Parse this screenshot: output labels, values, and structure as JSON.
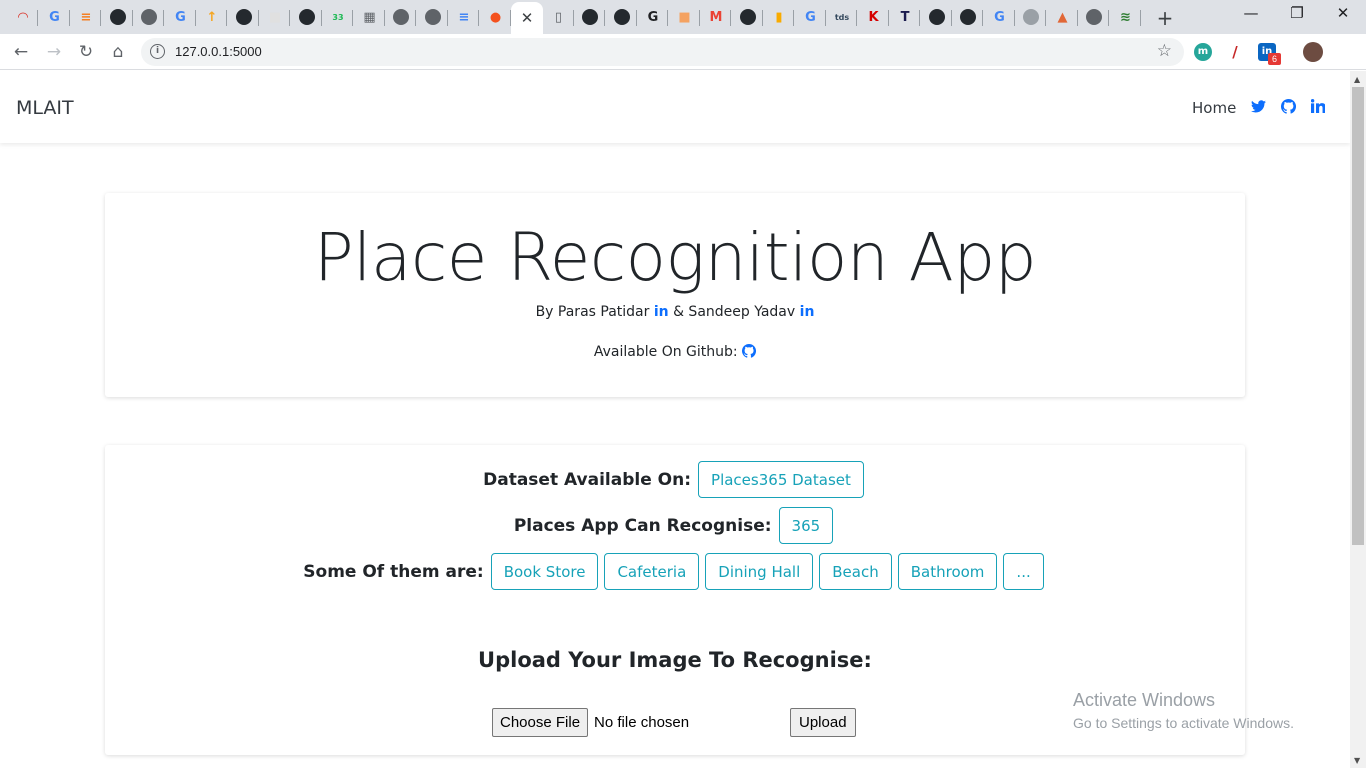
{
  "browser": {
    "active_tab_close": "✕",
    "new_tab": "+",
    "window_controls": [
      "—",
      "❐",
      "✕"
    ],
    "url": "127.0.0.1:5000",
    "star": "☆",
    "nav": {
      "back": "←",
      "forward": "→",
      "reload": "↻",
      "home": "⌂"
    },
    "tabs": [
      {
        "icon": "speedometer-icon",
        "color": "#d93025",
        "glyph": "◠"
      },
      {
        "icon": "google-icon",
        "color": "#4285f4",
        "glyph": "G"
      },
      {
        "icon": "stackoverflow-icon",
        "color": "#f48024",
        "glyph": "≡"
      },
      {
        "icon": "github-icon",
        "color": "#24292e",
        "glyph": "●"
      },
      {
        "icon": "globe-icon",
        "color": "#5f6368",
        "glyph": "●"
      },
      {
        "icon": "google-icon",
        "color": "#4285f4",
        "glyph": "G"
      },
      {
        "icon": "upload-icon",
        "color": "#f5a623",
        "glyph": "↑"
      },
      {
        "icon": "github-icon",
        "color": "#24292e",
        "glyph": "●"
      },
      {
        "icon": "cube-icon",
        "color": "#e0e0e0",
        "glyph": "■"
      },
      {
        "icon": "github-icon",
        "color": "#24292e",
        "glyph": "●"
      },
      {
        "icon": "badge-33-icon",
        "color": "#1db954",
        "glyph": "33"
      },
      {
        "icon": "qr-icon",
        "color": "#5f6368",
        "glyph": "▦"
      },
      {
        "icon": "globe-icon",
        "color": "#5f6368",
        "glyph": "●"
      },
      {
        "icon": "globe-icon",
        "color": "#5f6368",
        "glyph": "●"
      },
      {
        "icon": "docs-icon",
        "color": "#4285f4",
        "glyph": "≡"
      },
      {
        "icon": "orange-circle-icon",
        "color": "#f4511e",
        "glyph": "●"
      },
      {
        "icon": "tab-close-icon",
        "color": "#3c4043",
        "glyph": "✕"
      },
      {
        "icon": "document-icon",
        "color": "#5f6368",
        "glyph": "▯"
      },
      {
        "icon": "github-icon",
        "color": "#24292e",
        "glyph": "●"
      },
      {
        "icon": "github-icon",
        "color": "#24292e",
        "glyph": "●"
      },
      {
        "icon": "g-square-icon",
        "color": "#202124",
        "glyph": "G"
      },
      {
        "icon": "orange-square-icon",
        "color": "#f4a261",
        "glyph": "■"
      },
      {
        "icon": "gmail-icon",
        "color": "#ea4335",
        "glyph": "M"
      },
      {
        "icon": "github-icon",
        "color": "#24292e",
        "glyph": "●"
      },
      {
        "icon": "analytics-icon",
        "color": "#f9ab00",
        "glyph": "▮"
      },
      {
        "icon": "google-icon",
        "color": "#4285f4",
        "glyph": "G"
      },
      {
        "icon": "tds-icon",
        "color": "#35495e",
        "glyph": "tds"
      },
      {
        "icon": "k-icon",
        "color": "#d50000",
        "glyph": "K"
      },
      {
        "icon": "t-icon",
        "color": "#1a1a4e",
        "glyph": "T"
      },
      {
        "icon": "github-icon",
        "color": "#24292e",
        "glyph": "●"
      },
      {
        "icon": "github-icon",
        "color": "#24292e",
        "glyph": "●"
      },
      {
        "icon": "google-icon",
        "color": "#4285f4",
        "glyph": "G"
      },
      {
        "icon": "globe-icon",
        "color": "#9aa0a6",
        "glyph": "●"
      },
      {
        "icon": "matlab-icon",
        "color": "#e16737",
        "glyph": "▲"
      },
      {
        "icon": "globe-icon",
        "color": "#5f6368",
        "glyph": "●"
      },
      {
        "icon": "stripes-icon",
        "color": "#2e7d32",
        "glyph": "≋"
      }
    ],
    "extensions": [
      {
        "icon": "mendeley-icon",
        "color": "#26a69a",
        "glyph": "m"
      },
      {
        "icon": "pen-icon",
        "color": "#c62828",
        "glyph": "/"
      },
      {
        "icon": "linkedin-icon",
        "color": "#0a66c2",
        "glyph": "in"
      },
      {
        "icon": "profile-avatar-icon",
        "color": "#6d4c41",
        "glyph": "●"
      }
    ],
    "linkedin_badge": "6",
    "menu": "⋮"
  },
  "navbar": {
    "brand": "MLAIT",
    "home": "Home",
    "twitter_icon": "twitter-icon",
    "github_icon": "github-icon",
    "linkedin_icon": "linkedin-icon"
  },
  "hero": {
    "title": "Place Recognition App",
    "by_prefix": "By Paras Patidar",
    "by_middle": "& Sandeep Yadav",
    "github_label": "Available On Github:",
    "linkedin_glyph": "in"
  },
  "info": {
    "dataset_label": "Dataset Available On:",
    "dataset_button": "Places365 Dataset",
    "count_label": "Places App Can Recognise:",
    "count_button": "365",
    "examples_label": "Some Of them are:",
    "examples": [
      "Book Store",
      "Cafeteria",
      "Dining Hall",
      "Beach",
      "Bathroom",
      "..."
    ]
  },
  "upload": {
    "title": "Upload Your Image To Recognise:",
    "choose_button": "Choose File",
    "file_status": "No file chosen",
    "upload_button": "Upload"
  },
  "watermark": {
    "line1": "Activate Windows",
    "line2": "Go to Settings to activate Windows."
  }
}
